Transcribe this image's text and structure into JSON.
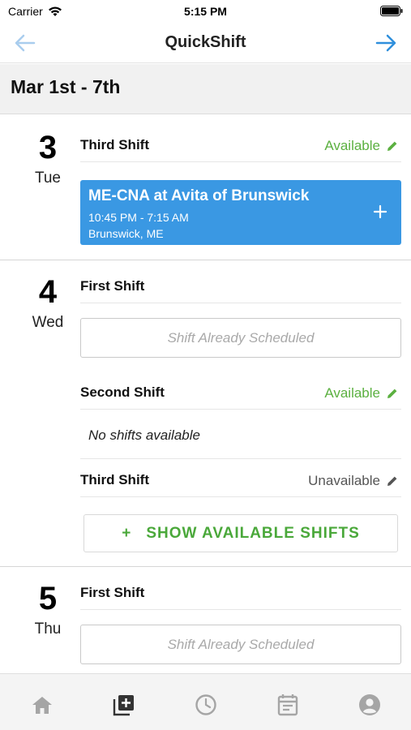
{
  "status_bar": {
    "carrier": "Carrier",
    "time": "5:15 PM"
  },
  "nav": {
    "title": "QuickShift"
  },
  "week": {
    "range": "Mar 1st - 7th"
  },
  "days": [
    {
      "number": "3",
      "name": "Tue",
      "shifts": [
        {
          "name": "Third Shift",
          "status": "Available"
        }
      ],
      "job": {
        "title": "ME-CNA at Avita of Brunswick",
        "time": "10:45 PM - 7:15 AM",
        "location": "Brunswick, ME"
      }
    },
    {
      "number": "4",
      "name": "Wed",
      "shifts": [
        {
          "name": "First Shift",
          "note": "Shift Already Scheduled"
        },
        {
          "name": "Second Shift",
          "status": "Available",
          "note": "No shifts available"
        },
        {
          "name": "Third Shift",
          "status": "Unavailable"
        }
      ],
      "show_button": "SHOW AVAILABLE SHIFTS"
    },
    {
      "number": "5",
      "name": "Thu",
      "shifts": [
        {
          "name": "First Shift",
          "note": "Shift Already Scheduled"
        }
      ]
    }
  ],
  "tabs": [
    {
      "icon": "home-icon",
      "active": false
    },
    {
      "icon": "add-shift-icon",
      "active": true
    },
    {
      "icon": "clock-icon",
      "active": false
    },
    {
      "icon": "calendar-icon",
      "active": false
    },
    {
      "icon": "account-icon",
      "active": false
    }
  ],
  "colors": {
    "accent_blue": "#3a98e3",
    "available_green": "#5bb040",
    "button_green": "#4aa83a",
    "tab_inactive": "#a5a5a5",
    "tab_active": "#333333"
  }
}
